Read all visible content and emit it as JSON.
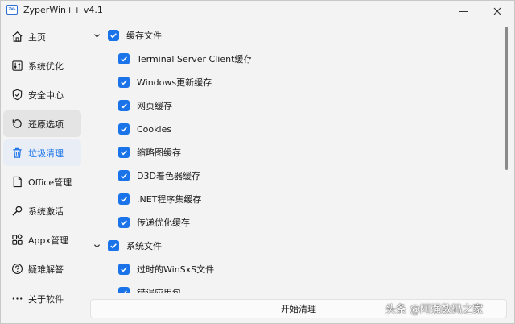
{
  "window": {
    "title": "ZyperWin++ v4.1",
    "icon_text": "ZW+"
  },
  "sidebar": {
    "items": [
      {
        "label": "主页",
        "icon": "home-icon"
      },
      {
        "label": "系统优化",
        "icon": "tune-icon"
      },
      {
        "label": "安全中心",
        "icon": "shield-icon"
      },
      {
        "label": "还原选项",
        "icon": "restore-icon"
      },
      {
        "label": "垃圾清理",
        "icon": "trash-icon"
      },
      {
        "label": "Office管理",
        "icon": "document-icon"
      },
      {
        "label": "系统激活",
        "icon": "key-icon"
      },
      {
        "label": "Appx管理",
        "icon": "apps-icon"
      },
      {
        "label": "疑难解答",
        "icon": "help-icon"
      },
      {
        "label": "关于软件",
        "icon": "more-icon"
      }
    ],
    "active_index": 4,
    "hover_index": 3
  },
  "tree": {
    "groups": [
      {
        "label": "缓存文件",
        "checked": true,
        "expanded": true,
        "children": [
          {
            "label": "Terminal Server Client缓存",
            "checked": true
          },
          {
            "label": "Windows更新缓存",
            "checked": true
          },
          {
            "label": "网页缓存",
            "checked": true
          },
          {
            "label": "Cookies",
            "checked": true
          },
          {
            "label": "缩略图缓存",
            "checked": true
          },
          {
            "label": "D3D着色器缓存",
            "checked": true
          },
          {
            "label": ".NET程序集缓存",
            "checked": true
          },
          {
            "label": "传递优化缓存",
            "checked": true
          }
        ]
      },
      {
        "label": "系统文件",
        "checked": true,
        "expanded": true,
        "children": [
          {
            "label": "过时的WinSxS文件",
            "checked": true
          },
          {
            "label": "错误应用包",
            "checked": true
          }
        ]
      }
    ]
  },
  "actions": {
    "start_label": "开始清理"
  },
  "watermark": "头条 @阿强数码之家",
  "colors": {
    "accent": "#1a73e8",
    "background": "#f3f3f3"
  }
}
